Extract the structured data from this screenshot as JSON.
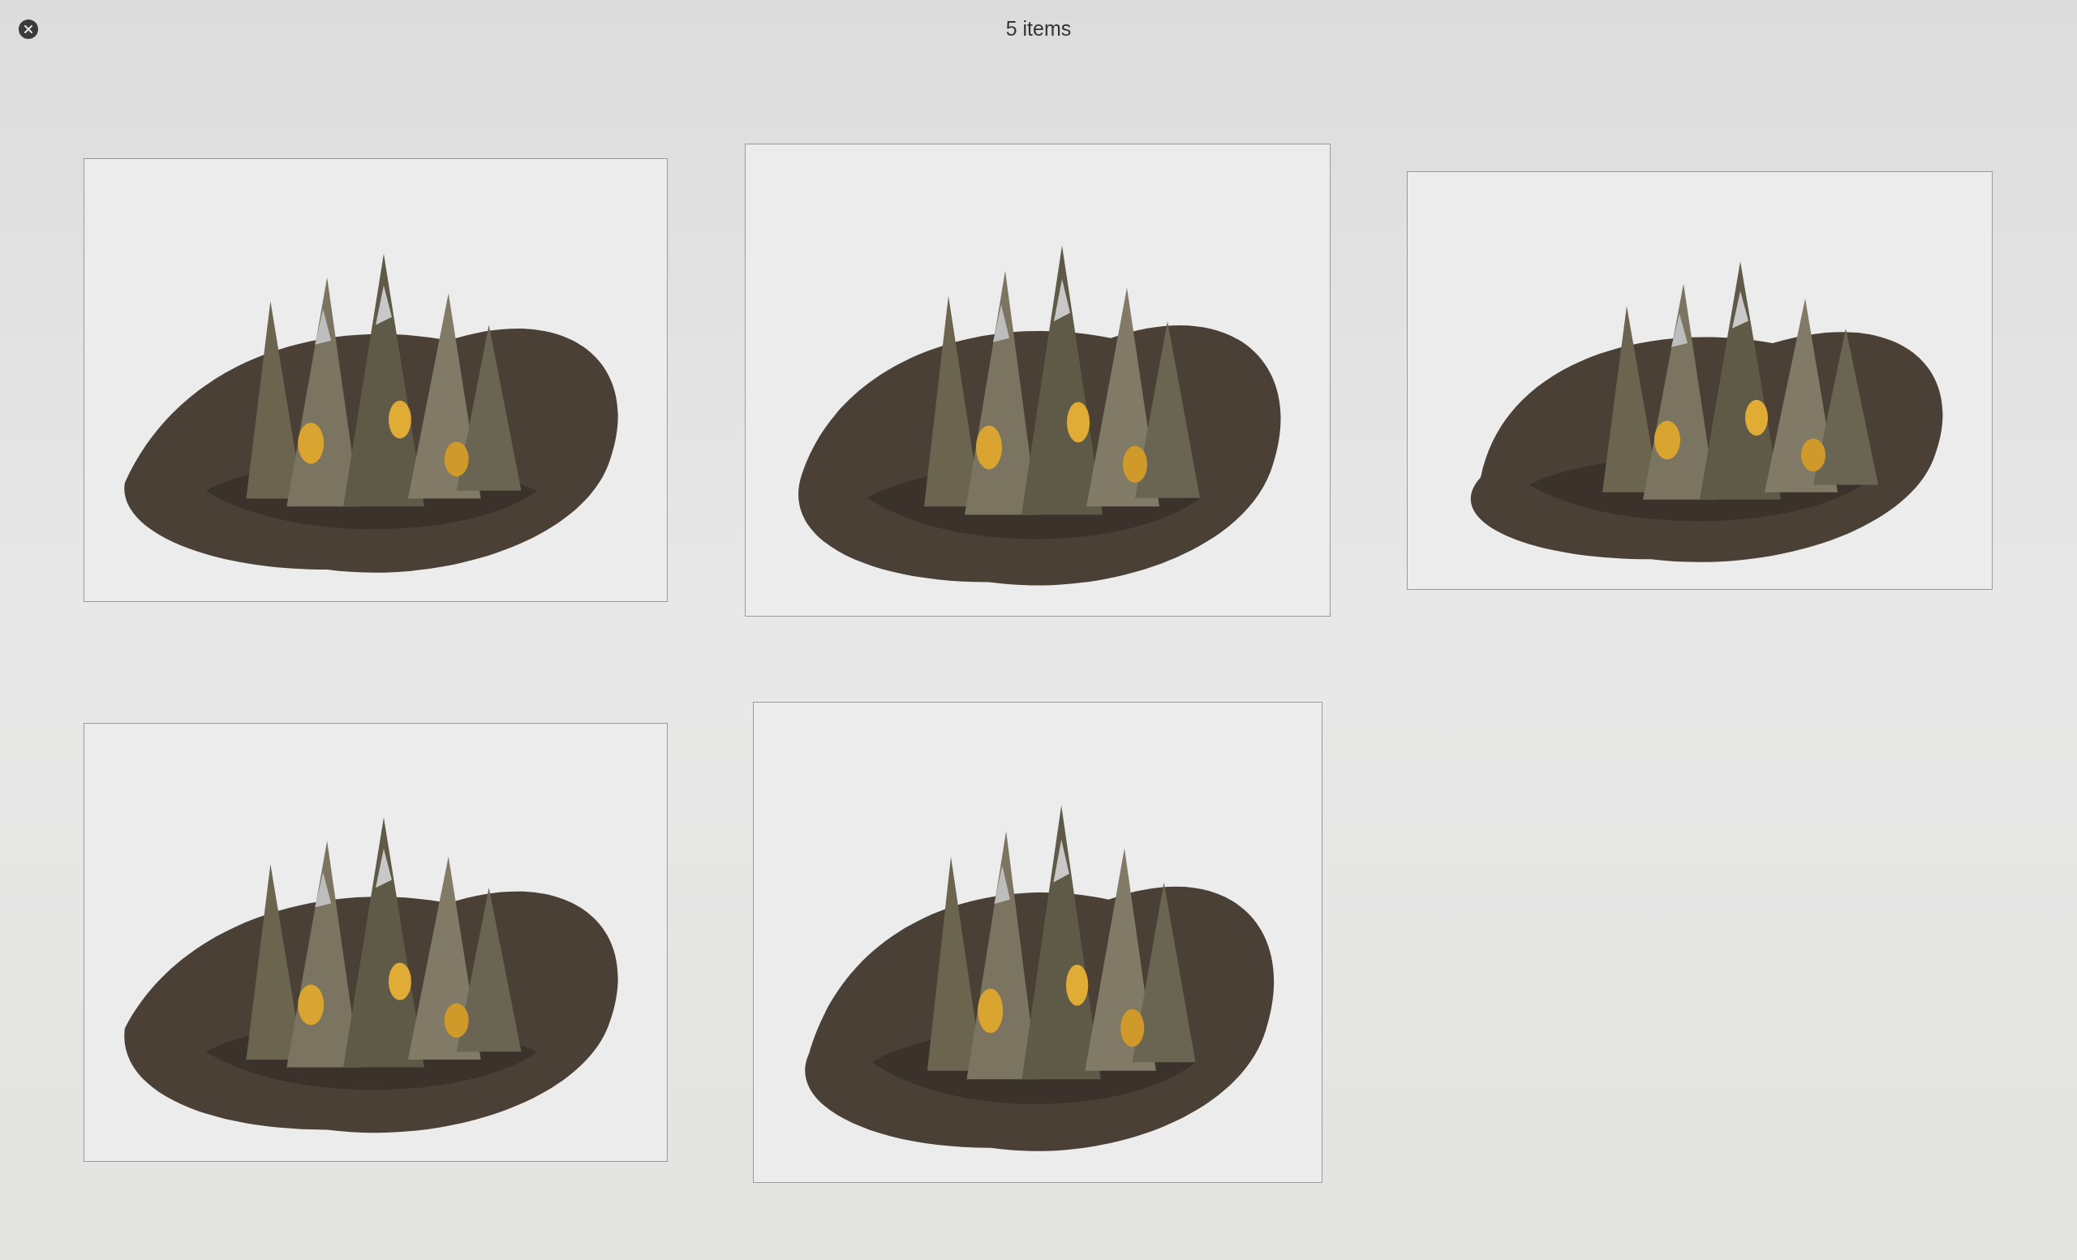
{
  "window": {
    "title": "5 items"
  }
}
